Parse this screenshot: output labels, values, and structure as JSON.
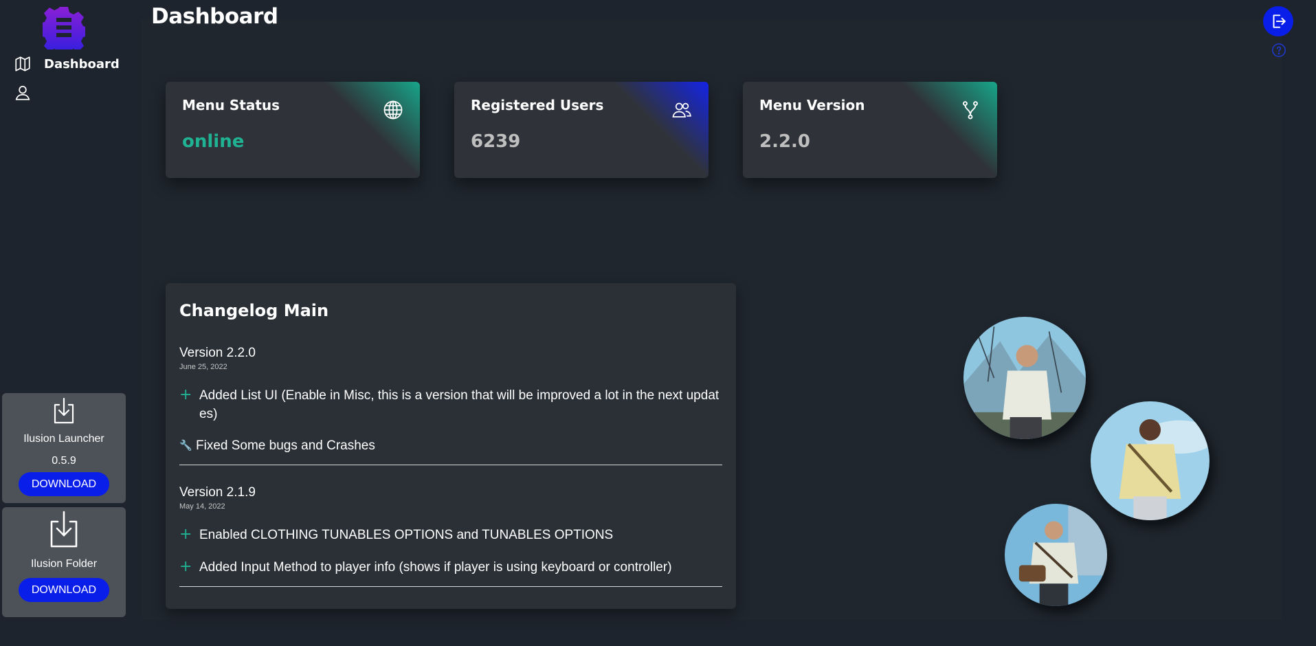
{
  "header": {
    "title": "Dashboard"
  },
  "sidebar": {
    "items": [
      {
        "label": "Dashboard",
        "icon": "map-icon"
      },
      {
        "label": "",
        "icon": "user-icon"
      }
    ]
  },
  "stats": [
    {
      "title": "Menu Status",
      "value": "online",
      "icon": "globe-icon",
      "accent": "#17a589"
    },
    {
      "title": "Registered Users",
      "value": "6239",
      "icon": "users-icon",
      "accent": "#1424e6"
    },
    {
      "title": "Menu Version",
      "value": "2.2.0",
      "icon": "git-fork-icon",
      "accent": "#17a589"
    }
  ],
  "downloads": [
    {
      "title": "Ilusion Launcher",
      "version": "0.5.9",
      "button": "DOWNLOAD"
    },
    {
      "title": "Ilusion Folder",
      "button": "DOWNLOAD"
    }
  ],
  "changelog": {
    "title": "Changelog Main",
    "versions": [
      {
        "version": "Version 2.2.0",
        "date": "June 25, 2022",
        "items": [
          {
            "type": "add",
            "text": "Added List UI (Enable in Misc, this is a version that will be improved a lot in the next updates)"
          },
          {
            "type": "fix",
            "text": "Fixed Some bugs and Crashes"
          }
        ]
      },
      {
        "version": "Version 2.1.9",
        "date": "May 14, 2022",
        "items": [
          {
            "type": "add",
            "text": "Enabled CLOTHING TUNABLES OPTIONS and TUNABLES OPTIONS"
          },
          {
            "type": "add",
            "text": "Added Input Method to player info (shows if player is using keyboard or controller)"
          }
        ]
      }
    ]
  },
  "colors": {
    "brand_blue": "#0a1eea",
    "accent_green": "#1fb394",
    "background": "#1e242d",
    "card": "#2f3339"
  },
  "icons": {
    "logout": "logout-icon",
    "help": "help-icon",
    "download": "download-icon",
    "logo": "gear-logo-icon"
  }
}
